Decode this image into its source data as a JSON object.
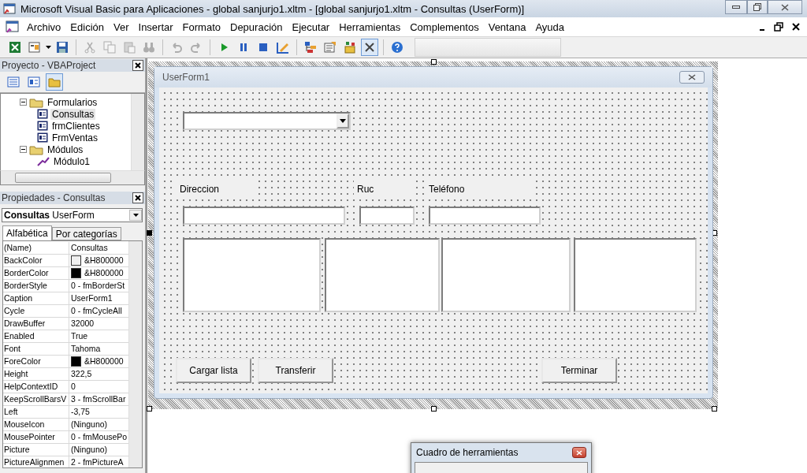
{
  "window": {
    "title": "Microsoft Visual Basic para Aplicaciones - global sanjurjo1.xltm - [global sanjurjo1.xltm - Consultas (UserForm)]"
  },
  "menu": [
    "Archivo",
    "Edición",
    "Ver",
    "Insertar",
    "Formato",
    "Depuración",
    "Ejecutar",
    "Herramientas",
    "Complementos",
    "Ventana",
    "Ayuda"
  ],
  "toolbar": [
    [
      {
        "kind": "excel",
        "disabled": false,
        "pressed": false
      },
      {
        "kind": "insert-form",
        "disabled": false,
        "pressed": false
      },
      {
        "kind": "save",
        "disabled": false,
        "pressed": false
      }
    ],
    [
      {
        "kind": "cut",
        "disabled": true,
        "pressed": false
      },
      {
        "kind": "copy",
        "disabled": true,
        "pressed": false
      },
      {
        "kind": "paste",
        "disabled": true,
        "pressed": false
      },
      {
        "kind": "find",
        "disabled": true,
        "pressed": false
      }
    ],
    [
      {
        "kind": "undo",
        "disabled": true,
        "pressed": false
      },
      {
        "kind": "redo",
        "disabled": true,
        "pressed": false
      }
    ],
    [
      {
        "kind": "run",
        "disabled": false,
        "pressed": false
      },
      {
        "kind": "pause",
        "disabled": false,
        "pressed": false
      },
      {
        "kind": "stop",
        "disabled": false,
        "pressed": false
      },
      {
        "kind": "design",
        "disabled": false,
        "pressed": false
      }
    ],
    [
      {
        "kind": "explorer",
        "disabled": false,
        "pressed": false
      },
      {
        "kind": "properties",
        "disabled": false,
        "pressed": false
      },
      {
        "kind": "browser",
        "disabled": false,
        "pressed": false
      },
      {
        "kind": "toolbox",
        "disabled": false,
        "pressed": true
      }
    ],
    [
      {
        "kind": "help",
        "disabled": false,
        "pressed": false
      }
    ]
  ],
  "project": {
    "title": "Proyecto - VBAProject",
    "tools": [
      {
        "kind": "code",
        "selected": false
      },
      {
        "kind": "object",
        "selected": false
      },
      {
        "kind": "folders",
        "selected": true
      }
    ],
    "tree": [
      {
        "label": "Formularios",
        "kind": "folder",
        "expanded": true,
        "selected": false,
        "children": [
          {
            "label": "Consultas",
            "kind": "form",
            "selected": true
          },
          {
            "label": "frmClientes",
            "kind": "form",
            "selected": false
          },
          {
            "label": "FrmVentas",
            "kind": "form",
            "selected": false
          }
        ]
      },
      {
        "label": "Módulos",
        "kind": "folder",
        "expanded": true,
        "selected": false,
        "children": [
          {
            "label": "Módulo1",
            "kind": "module",
            "selected": false
          }
        ]
      }
    ]
  },
  "properties": {
    "title": "Propiedades - Consultas",
    "object": "**Consultas** UserForm",
    "tabs": [
      {
        "label": "Alfabética",
        "selected": true
      },
      {
        "label": "Por categorías",
        "selected": false
      }
    ],
    "rows": [
      {
        "name": "(Name)",
        "value": "Consultas"
      },
      {
        "name": "BackColor",
        "value": "&H800000",
        "color": "#f0f0f0"
      },
      {
        "name": "BorderColor",
        "value": "&H800000",
        "color": "#000000"
      },
      {
        "name": "BorderStyle",
        "value": "0 - fmBorderSt"
      },
      {
        "name": "Caption",
        "value": "UserForm1"
      },
      {
        "name": "Cycle",
        "value": "0 - fmCycleAll"
      },
      {
        "name": "DrawBuffer",
        "value": "32000"
      },
      {
        "name": "Enabled",
        "value": "True"
      },
      {
        "name": "Font",
        "value": "Tahoma"
      },
      {
        "name": "ForeColor",
        "value": "&H800000",
        "color": "#000000"
      },
      {
        "name": "Height",
        "value": "322,5"
      },
      {
        "name": "HelpContextID",
        "value": "0"
      },
      {
        "name": "KeepScrollBarsV",
        "value": "3 - fmScrollBar"
      },
      {
        "name": "Left",
        "value": "-3,75"
      },
      {
        "name": "MouseIcon",
        "value": "(Ninguno)"
      },
      {
        "name": "MousePointer",
        "value": "0 - fmMousePo"
      },
      {
        "name": "Picture",
        "value": "(Ninguno)"
      },
      {
        "name": "PictureAlignmen",
        "value": "2 - fmPictureA"
      }
    ]
  },
  "form": {
    "title": "UserForm1",
    "controls": [
      {
        "kind": "combobox"
      },
      {
        "kind": "label",
        "text": "Direccion"
      },
      {
        "kind": "label",
        "text": "Ruc"
      },
      {
        "kind": "label",
        "text": "Teléfono"
      },
      {
        "kind": "textbox"
      },
      {
        "kind": "textbox"
      },
      {
        "kind": "textbox"
      },
      {
        "kind": "listbox"
      },
      {
        "kind": "listbox"
      },
      {
        "kind": "listbox"
      },
      {
        "kind": "listbox"
      },
      {
        "kind": "button",
        "text": "Cargar lista"
      },
      {
        "kind": "button",
        "text": "Transferir"
      },
      {
        "kind": "button",
        "text": "Terminar"
      }
    ]
  },
  "toolbox": {
    "title": "Cuadro de herramientas"
  }
}
